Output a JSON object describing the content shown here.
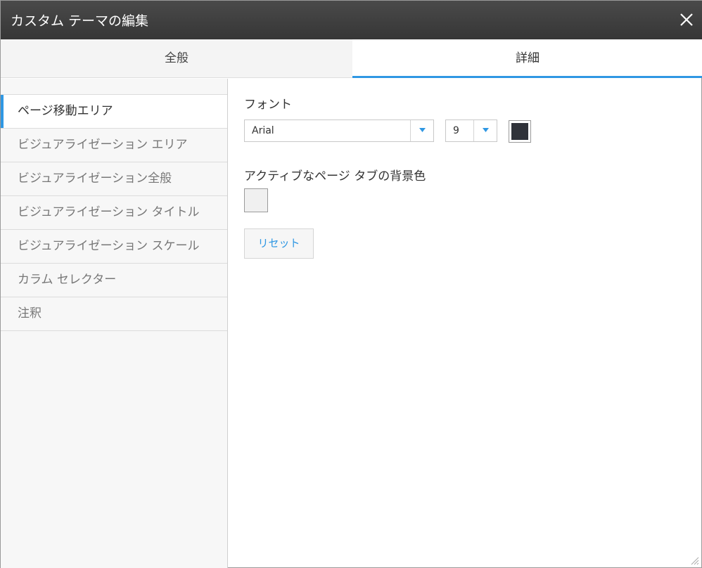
{
  "dialog": {
    "title": "カスタム テーマの編集",
    "close_icon": "close-icon"
  },
  "tabs": [
    {
      "label": "全般",
      "active": false
    },
    {
      "label": "詳細",
      "active": true
    }
  ],
  "sidebar": {
    "items": [
      {
        "label": "ページ移動エリア",
        "active": true
      },
      {
        "label": "ビジュアライゼーション エリア",
        "active": false
      },
      {
        "label": "ビジュアライゼーション全般",
        "active": false
      },
      {
        "label": "ビジュアライゼーション タイトル",
        "active": false
      },
      {
        "label": "ビジュアライゼーション スケール",
        "active": false
      },
      {
        "label": "カラム セレクター",
        "active": false
      },
      {
        "label": "注釈",
        "active": false
      }
    ]
  },
  "font_section": {
    "label": "フォント",
    "font_family": "Arial",
    "font_size": "9",
    "font_color": "#2f3239"
  },
  "active_tab_bg_section": {
    "label": "アクティブなページ タブの背景色",
    "color": "#f0f0f0"
  },
  "reset_label": "リセット",
  "colors": {
    "accent": "#2f97e3",
    "titlebar": "#3e3e3e"
  }
}
